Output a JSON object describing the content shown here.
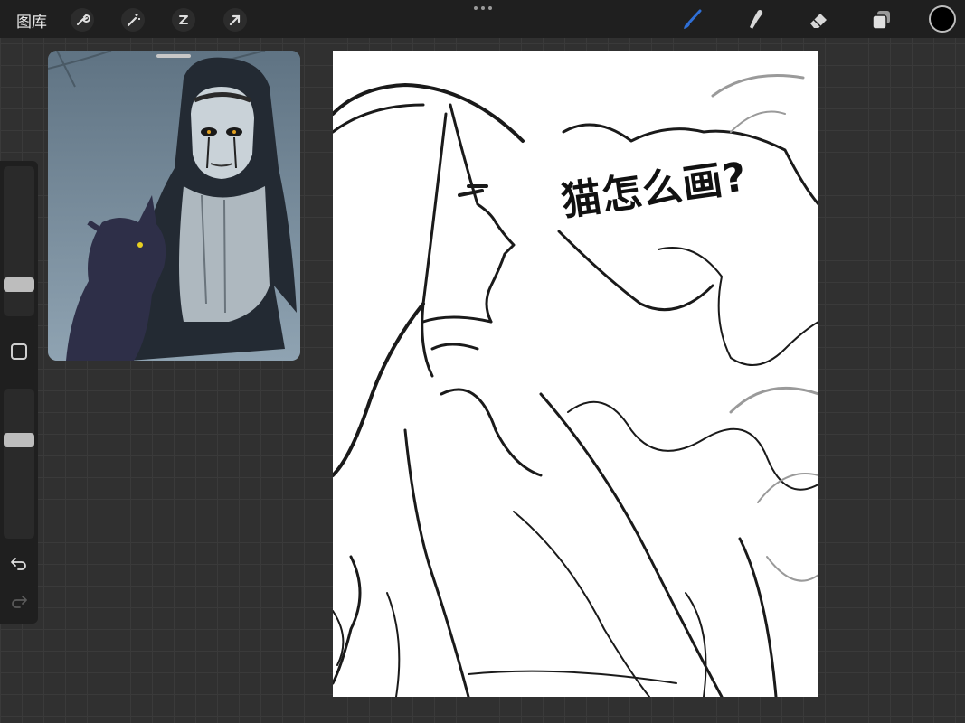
{
  "topbar": {
    "gallery_label": "图库",
    "tools": [
      "wrench-icon",
      "magic-wand-icon",
      "selection-icon",
      "transform-arrow-icon"
    ],
    "right_tools": [
      "brush-icon",
      "smudge-icon",
      "eraser-icon",
      "layers-icon"
    ],
    "active_tool": "brush-icon",
    "active_color": "#000000",
    "accent_color": "#2f6fd6"
  },
  "sidebar": {
    "brush_size_level": 0.5,
    "opacity_level": 0.6,
    "undo_icon": "undo-icon",
    "redo_icon": "redo-icon"
  },
  "canvas": {
    "sketch_text": "猫怎么画?"
  }
}
